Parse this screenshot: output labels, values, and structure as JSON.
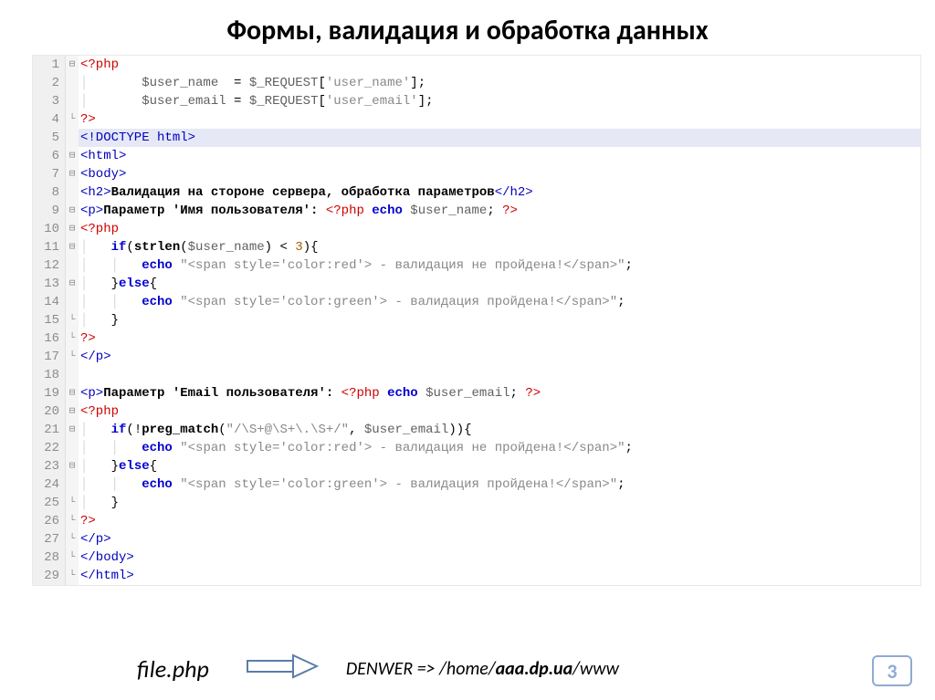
{
  "title": "Формы, валидация и обработка данных",
  "file_label": "file.php",
  "path_prefix": "DENWER => /home/",
  "path_bold": "aaa.dp.ua",
  "path_suffix": "/www",
  "slide_number": "3",
  "lines": [
    {
      "n": "1",
      "f": "⊟",
      "tokens": [
        [
          "php-tag",
          "<?php"
        ]
      ]
    },
    {
      "n": "2",
      "f": "",
      "tokens": [
        [
          "guide",
          "│       "
        ],
        [
          "var",
          "$user_name"
        ],
        [
          "op",
          "  = "
        ],
        [
          "var",
          "$_REQUEST"
        ],
        [
          "op",
          "["
        ],
        [
          "str",
          "'user_name'"
        ],
        [
          "op",
          "];"
        ]
      ]
    },
    {
      "n": "3",
      "f": "",
      "tokens": [
        [
          "guide",
          "│       "
        ],
        [
          "var",
          "$user_email"
        ],
        [
          "op",
          " = "
        ],
        [
          "var",
          "$_REQUEST"
        ],
        [
          "op",
          "["
        ],
        [
          "str",
          "'user_email'"
        ],
        [
          "op",
          "];"
        ]
      ]
    },
    {
      "n": "4",
      "f": "└",
      "tokens": [
        [
          "php-tag",
          "?>"
        ]
      ]
    },
    {
      "n": "5",
      "f": "",
      "hl": true,
      "tokens": [
        [
          "tag",
          "<!DOCTYPE html>"
        ]
      ]
    },
    {
      "n": "6",
      "f": "⊟",
      "tokens": [
        [
          "tag",
          "<html>"
        ]
      ]
    },
    {
      "n": "7",
      "f": "⊟",
      "tokens": [
        [
          "tag",
          "<body>"
        ]
      ]
    },
    {
      "n": "8",
      "f": "",
      "tokens": [
        [
          "tag",
          "<h2>"
        ],
        [
          "bold",
          "Валидация на стороне сервера, обработка параметров"
        ],
        [
          "tag",
          "</h2>"
        ]
      ]
    },
    {
      "n": "9",
      "f": "⊟",
      "tokens": [
        [
          "tag",
          "<p>"
        ],
        [
          "bold",
          "Параметр 'Имя пользователя': "
        ],
        [
          "php-tag",
          "<?php "
        ],
        [
          "kw",
          "echo "
        ],
        [
          "var",
          "$user_name"
        ],
        [
          "op",
          "; "
        ],
        [
          "php-tag",
          "?>"
        ]
      ]
    },
    {
      "n": "10",
      "f": "⊟",
      "tokens": [
        [
          "php-tag",
          "<?php"
        ]
      ]
    },
    {
      "n": "11",
      "f": "⊟",
      "tokens": [
        [
          "guide",
          "│   "
        ],
        [
          "kw",
          "if"
        ],
        [
          "op",
          "("
        ],
        [
          "fn",
          "strlen"
        ],
        [
          "op",
          "("
        ],
        [
          "var",
          "$user_name"
        ],
        [
          "op",
          ") < "
        ],
        [
          "num",
          "3"
        ],
        [
          "op",
          "){"
        ]
      ]
    },
    {
      "n": "12",
      "f": "",
      "tokens": [
        [
          "guide",
          "│   │   "
        ],
        [
          "kw",
          "echo "
        ],
        [
          "str",
          "\"<span style='color:red'> - валидация не пройдена!</span>\""
        ],
        [
          "op",
          ";"
        ]
      ]
    },
    {
      "n": "13",
      "f": "⊟",
      "tokens": [
        [
          "guide",
          "│   "
        ],
        [
          "op",
          "}"
        ],
        [
          "kw",
          "else"
        ],
        [
          "op",
          "{"
        ]
      ]
    },
    {
      "n": "14",
      "f": "",
      "tokens": [
        [
          "guide",
          "│   │   "
        ],
        [
          "kw",
          "echo "
        ],
        [
          "str",
          "\"<span style='color:green'> - валидация пройдена!</span>\""
        ],
        [
          "op",
          ";"
        ]
      ]
    },
    {
      "n": "15",
      "f": "└",
      "tokens": [
        [
          "guide",
          "│   "
        ],
        [
          "op",
          "}"
        ]
      ]
    },
    {
      "n": "16",
      "f": "└",
      "tokens": [
        [
          "php-tag",
          "?>"
        ]
      ]
    },
    {
      "n": "17",
      "f": "└",
      "tokens": [
        [
          "tag",
          "</p>"
        ]
      ]
    },
    {
      "n": "18",
      "f": "",
      "tokens": []
    },
    {
      "n": "19",
      "f": "⊟",
      "tokens": [
        [
          "tag",
          "<p>"
        ],
        [
          "bold",
          "Параметр 'Email пользователя': "
        ],
        [
          "php-tag",
          "<?php "
        ],
        [
          "kw",
          "echo "
        ],
        [
          "var",
          "$user_email"
        ],
        [
          "op",
          "; "
        ],
        [
          "php-tag",
          "?>"
        ]
      ]
    },
    {
      "n": "20",
      "f": "⊟",
      "tokens": [
        [
          "php-tag",
          "<?php"
        ]
      ]
    },
    {
      "n": "21",
      "f": "⊟",
      "tokens": [
        [
          "guide",
          "│   "
        ],
        [
          "kw",
          "if"
        ],
        [
          "op",
          "(!"
        ],
        [
          "fn",
          "preg_match"
        ],
        [
          "op",
          "("
        ],
        [
          "str",
          "\"/\\S+@\\S+\\.\\S+/\""
        ],
        [
          "op",
          ", "
        ],
        [
          "var",
          "$user_email"
        ],
        [
          "op",
          ")){"
        ]
      ]
    },
    {
      "n": "22",
      "f": "",
      "tokens": [
        [
          "guide",
          "│   │   "
        ],
        [
          "kw",
          "echo "
        ],
        [
          "str",
          "\"<span style='color:red'> - валидация не пройдена!</span>\""
        ],
        [
          "op",
          ";"
        ]
      ]
    },
    {
      "n": "23",
      "f": "⊟",
      "tokens": [
        [
          "guide",
          "│   "
        ],
        [
          "op",
          "}"
        ],
        [
          "kw",
          "else"
        ],
        [
          "op",
          "{"
        ]
      ]
    },
    {
      "n": "24",
      "f": "",
      "tokens": [
        [
          "guide",
          "│   │   "
        ],
        [
          "kw",
          "echo "
        ],
        [
          "str",
          "\"<span style='color:green'> - валидация пройдена!</span>\""
        ],
        [
          "op",
          ";"
        ]
      ]
    },
    {
      "n": "25",
      "f": "└",
      "tokens": [
        [
          "guide",
          "│   "
        ],
        [
          "op",
          "}"
        ]
      ]
    },
    {
      "n": "26",
      "f": "└",
      "tokens": [
        [
          "php-tag",
          "?>"
        ]
      ]
    },
    {
      "n": "27",
      "f": "└",
      "tokens": [
        [
          "tag",
          "</p>"
        ]
      ]
    },
    {
      "n": "28",
      "f": "└",
      "tokens": [
        [
          "tag",
          "</body>"
        ]
      ]
    },
    {
      "n": "29",
      "f": "└",
      "tokens": [
        [
          "tag",
          "</html>"
        ]
      ]
    }
  ]
}
